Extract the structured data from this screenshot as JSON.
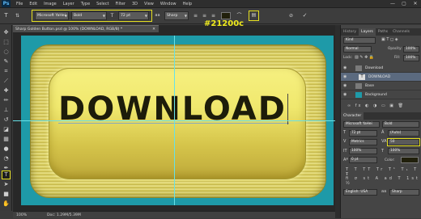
{
  "app": {
    "logo": "Ps"
  },
  "menu": [
    "File",
    "Edit",
    "Image",
    "Layer",
    "Type",
    "Select",
    "Filter",
    "3D",
    "View",
    "Window",
    "Help"
  ],
  "window_controls": [
    "—",
    "▢",
    "✕"
  ],
  "options": {
    "font_family": "Microsoft YaHei",
    "font_style": "Bold",
    "font_size": "72 pt",
    "antialias": "Sharp",
    "color_hex": "#21200c",
    "icons": [
      "type-tool-icon",
      "orientation-icon",
      "align-left-icon",
      "align-center-icon",
      "align-right-icon",
      "warp-text-icon",
      "character-panel-icon",
      "cancel-icon",
      "commit-icon"
    ]
  },
  "annotation": "#21200c",
  "document": {
    "tab_title": "Sharp Golden Button.psd @ 100% (DOWNLOAD, RGB/8) *",
    "button_text": "DOWNLOAD"
  },
  "status": {
    "zoom": "100%",
    "doc_size": "Doc: 1.29M/5.39M"
  },
  "layers_panel": {
    "tabs": [
      "History",
      "Layers",
      "Paths",
      "Channels"
    ],
    "active_tab": "Layers",
    "blend_mode": "Normal",
    "opacity_label": "Opacity:",
    "opacity": "100%",
    "lock_label": "Lock:",
    "fill_label": "Fill:",
    "fill": "100%",
    "kind": "Kind",
    "layers": [
      {
        "name": "Download",
        "type": "group"
      },
      {
        "name": "DOWNLOAD",
        "type": "text",
        "selected": true
      },
      {
        "name": "Base",
        "type": "group"
      },
      {
        "name": "Background",
        "type": "image"
      }
    ]
  },
  "character_panel": {
    "tab": "Character",
    "font_family": "Microsoft YaHei",
    "font_style": "Bold",
    "font_size": "72 pt",
    "leading": "(Auto)",
    "kerning": "Metrics",
    "tracking": "50",
    "vert_scale": "100%",
    "horiz_scale": "100%",
    "baseline_shift": "0 pt",
    "color_label": "Color:",
    "language": "English: USA",
    "antialias": "Sharp"
  }
}
